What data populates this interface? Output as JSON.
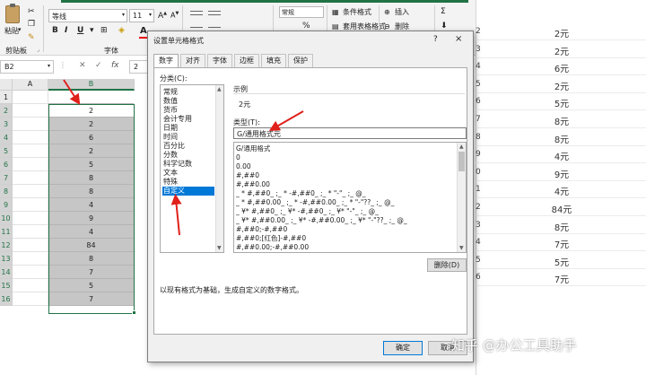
{
  "ribbon": {
    "paste_label": "粘贴",
    "clipboard_label": "剪贴板",
    "font_name": "等线",
    "font_size": "11",
    "bold": "B",
    "italic": "I",
    "underline": "U",
    "font_color": "A",
    "font_label": "字体",
    "number_format": "常规",
    "percent": "%",
    "conditional_format": "条件格式",
    "table_format": "套用表格格式",
    "insert": "插入",
    "delete": "删除",
    "sum": "Σ",
    "accent_color": "#217346"
  },
  "formula_bar": {
    "name_box": "B2",
    "fx": "fx",
    "value": "2"
  },
  "grid": {
    "columns": [
      "A",
      "B"
    ],
    "rows": [
      "1",
      "2",
      "3",
      "4",
      "5",
      "6",
      "7",
      "8",
      "9",
      "10",
      "11",
      "12",
      "13",
      "14",
      "15",
      "16"
    ],
    "b_values": [
      "2",
      "2",
      "6",
      "2",
      "5",
      "8",
      "8",
      "4",
      "9",
      "4",
      "84",
      "8",
      "7",
      "5",
      "7"
    ]
  },
  "right_sheet": {
    "rows": [
      {
        "num": "2",
        "val": "2元"
      },
      {
        "num": "3",
        "val": "2元"
      },
      {
        "num": "4",
        "val": "6元"
      },
      {
        "num": "5",
        "val": "2元"
      },
      {
        "num": "6",
        "val": "5元"
      },
      {
        "num": "7",
        "val": "8元"
      },
      {
        "num": "8",
        "val": "8元"
      },
      {
        "num": "9",
        "val": "4元"
      },
      {
        "num": "0",
        "val": "9元"
      },
      {
        "num": "1",
        "val": "4元"
      },
      {
        "num": "2",
        "val": "84元"
      },
      {
        "num": "3",
        "val": "8元"
      },
      {
        "num": "4",
        "val": "7元"
      },
      {
        "num": "5",
        "val": "5元"
      },
      {
        "num": "6",
        "val": "7元"
      }
    ]
  },
  "dialog": {
    "title": "设置单元格格式",
    "help": "?",
    "close": "×",
    "tabs": [
      "数字",
      "对齐",
      "字体",
      "边框",
      "填充",
      "保护"
    ],
    "category_label": "分类(C):",
    "categories": [
      "常规",
      "数值",
      "货币",
      "会计专用",
      "日期",
      "时间",
      "百分比",
      "分数",
      "科学记数",
      "文本",
      "特殊",
      "自定义"
    ],
    "selected_category": "自定义",
    "sample_label": "示例",
    "sample_value": "2元",
    "type_label": "类型(T):",
    "type_value": "G/通用格式元",
    "type_list": [
      "G/通用格式",
      "0",
      "0.00",
      "#,##0",
      "#,##0.00",
      "_ * #,##0_ ;_ * -#,##0_ ;_ * \"-\"_ ;_ @_",
      "_ * #,##0.00_ ;_ * -#,##0.00_ ;_ * \"-\"??_ ;_ @_",
      "_ ¥* #,##0_ ;_ ¥* -#,##0_ ;_ ¥* \"-\"_ ;_ @_",
      "_ ¥* #,##0.00_ ;_ ¥* -#,##0.00_ ;_ ¥* \"-\"??_ ;_ @_",
      "#,##0;-#,##0",
      "#,##0;[红色]-#,##0",
      "#,##0.00;-#,##0.00"
    ],
    "delete_button": "删除(D)",
    "description": "以现有格式为基础，生成自定义的数字格式。",
    "ok": "确定",
    "cancel": "取消"
  },
  "watermark": "知乎 @办公工具助手",
  "annotation_color": "#e0201b"
}
